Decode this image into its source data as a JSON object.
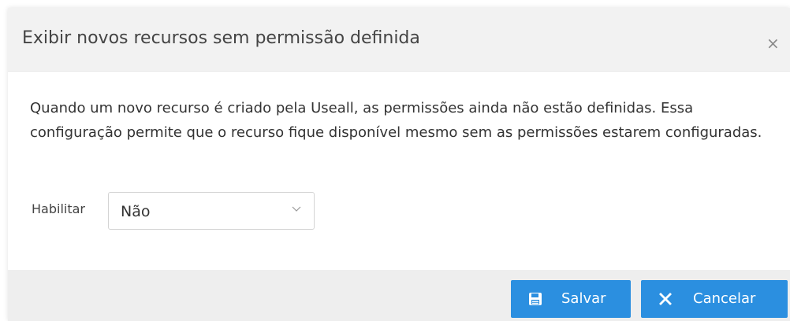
{
  "dialog": {
    "title": "Exibir novos recursos sem permissão definida",
    "close_symbol": "×",
    "description": "Quando um novo recurso é criado pela Useall, as permissões ainda não estão definidas. Essa configuração permite que o recurso fique disponível mesmo sem as permissões estarem configuradas.",
    "field": {
      "label": "Habilitar",
      "selected_value": "Não",
      "chevron_icon": "chevron-down-icon"
    },
    "footer": {
      "save": {
        "label": "Salvar",
        "icon": "save-icon"
      },
      "cancel": {
        "label": "Cancelar",
        "icon": "close-icon"
      }
    }
  },
  "colors": {
    "primary_button": "#2b8fe0",
    "header_bg": "#f2f2f2",
    "footer_bg": "#eeeeee"
  }
}
